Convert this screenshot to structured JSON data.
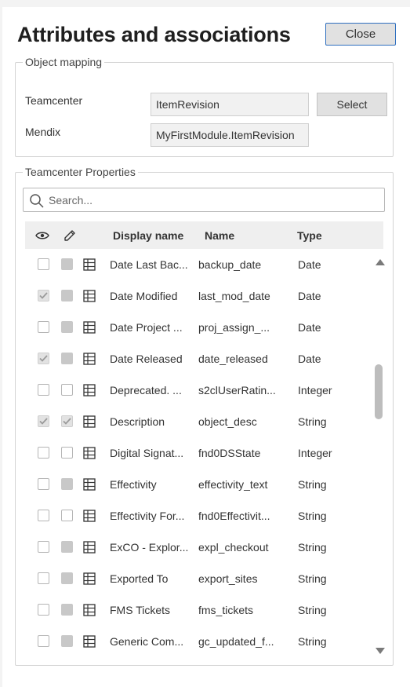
{
  "dialog": {
    "title": "Attributes and associations",
    "close_label": "Close"
  },
  "mapping": {
    "legend": "Object mapping",
    "teamcenter_label": "Teamcenter",
    "teamcenter_value": "ItemRevision",
    "select_label": "Select",
    "mendix_label": "Mendix",
    "mendix_value": "MyFirstModule.ItemRevision"
  },
  "properties": {
    "legend": "Teamcenter Properties",
    "search_placeholder": "Search...",
    "columns": {
      "visible_icon": "eye-icon",
      "editable_icon": "pencil-icon",
      "display_name": "Display name",
      "name": "Name",
      "type": "Type"
    },
    "rows": [
      {
        "display": "Date Last Bac...",
        "name": "backup_date",
        "type": "Date",
        "visible": false,
        "editable": false,
        "editable_disabled": true
      },
      {
        "display": "Date Modified",
        "name": "last_mod_date",
        "type": "Date",
        "visible": true,
        "editable": false,
        "editable_disabled": true
      },
      {
        "display": "Date Project ...",
        "name": "proj_assign_...",
        "type": "Date",
        "visible": false,
        "editable": false,
        "editable_disabled": true
      },
      {
        "display": "Date Released",
        "name": "date_released",
        "type": "Date",
        "visible": true,
        "editable": false,
        "editable_disabled": true
      },
      {
        "display": "Deprecated. ...",
        "name": "s2clUserRatin...",
        "type": "Integer",
        "visible": false,
        "editable": false,
        "editable_disabled": false
      },
      {
        "display": "Description",
        "name": "object_desc",
        "type": "String",
        "visible": true,
        "editable": true,
        "editable_disabled": false
      },
      {
        "display": "Digital Signat...",
        "name": "fnd0DSState",
        "type": "Integer",
        "visible": false,
        "editable": false,
        "editable_disabled": false
      },
      {
        "display": "Effectivity",
        "name": "effectivity_text",
        "type": "String",
        "visible": false,
        "editable": false,
        "editable_disabled": true
      },
      {
        "display": "Effectivity For...",
        "name": "fnd0Effectivit...",
        "type": "String",
        "visible": false,
        "editable": false,
        "editable_disabled": false
      },
      {
        "display": "ExCO - Explor...",
        "name": "expl_checkout",
        "type": "String",
        "visible": false,
        "editable": false,
        "editable_disabled": true
      },
      {
        "display": "Exported To",
        "name": "export_sites",
        "type": "String",
        "visible": false,
        "editable": false,
        "editable_disabled": true
      },
      {
        "display": "FMS Tickets",
        "name": "fms_tickets",
        "type": "String",
        "visible": false,
        "editable": false,
        "editable_disabled": true
      },
      {
        "display": "Generic Com...",
        "name": "gc_updated_f...",
        "type": "String",
        "visible": false,
        "editable": false,
        "editable_disabled": true
      }
    ],
    "row_icon": "table-icon"
  },
  "colors": {
    "accent_border": "#2f6fbf",
    "header_bg": "#efefef",
    "scroll_thumb": "#bdbdbd"
  }
}
